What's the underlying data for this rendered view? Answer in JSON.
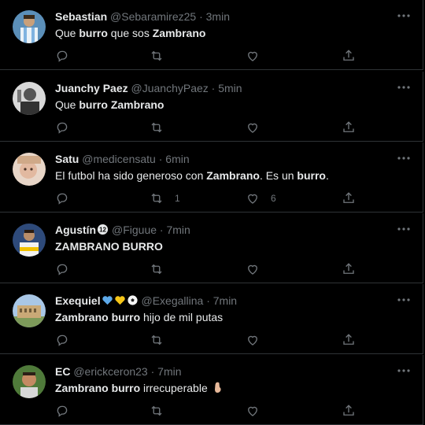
{
  "tweets": [
    {
      "name": "Sebastian",
      "handle": "@Sebaramirez25",
      "dot": "·",
      "time": "3min",
      "text_parts": [
        {
          "t": "Que ",
          "b": false
        },
        {
          "t": "burro",
          "b": true
        },
        {
          "t": " que sos ",
          "b": false
        },
        {
          "t": "Zambrano",
          "b": true
        }
      ],
      "retweets": "",
      "likes": "",
      "name_icons": []
    },
    {
      "name": "Juanchy Paez",
      "handle": "@JuanchyPaez",
      "dot": "·",
      "time": "5min",
      "text_parts": [
        {
          "t": "Que ",
          "b": false
        },
        {
          "t": "burro",
          "b": true
        },
        {
          "t": " ",
          "b": false
        },
        {
          "t": "Zambrano",
          "b": true
        }
      ],
      "retweets": "",
      "likes": "",
      "name_icons": []
    },
    {
      "name": "Satu",
      "handle": "@medicensatu",
      "dot": "·",
      "time": "6min",
      "text_parts": [
        {
          "t": "El futbol ha sido generoso con ",
          "b": false
        },
        {
          "t": "Zambrano",
          "b": true
        },
        {
          "t": ". Es un ",
          "b": false
        },
        {
          "t": "burro",
          "b": true
        },
        {
          "t": ".",
          "b": false
        }
      ],
      "retweets": "1",
      "likes": "6",
      "name_icons": []
    },
    {
      "name": "Agustín",
      "handle": "@Figuue",
      "dot": "·",
      "time": "7min",
      "text_parts": [
        {
          "t": "ZAMBRANO BURRO",
          "b": true
        }
      ],
      "retweets": "",
      "likes": "",
      "name_icons": [
        "number-12-circle-icon"
      ]
    },
    {
      "name": "Exequiel",
      "handle": "@Exegallina",
      "dot": "·",
      "time": "7min",
      "text_parts": [
        {
          "t": "Zambrano burro",
          "b": true
        },
        {
          "t": " hijo de mil putas",
          "b": false
        }
      ],
      "retweets": "",
      "likes": "",
      "name_icons": [
        "blue-heart-icon",
        "yellow-heart-icon",
        "soccer-ball-icon"
      ]
    },
    {
      "name": "EC",
      "handle": "@erickceron23",
      "dot": "·",
      "time": "7min",
      "text_parts": [
        {
          "t": "Zambrano burro",
          "b": true
        },
        {
          "t": " irrecuperable ",
          "b": false
        }
      ],
      "retweets": "",
      "likes": "",
      "name_icons": [],
      "text_icon": "pinched-fingers-icon"
    }
  ],
  "colors": {
    "background": "#000000",
    "text": "#e7e9ea",
    "muted": "#71767b",
    "divider": "#2f3336"
  }
}
